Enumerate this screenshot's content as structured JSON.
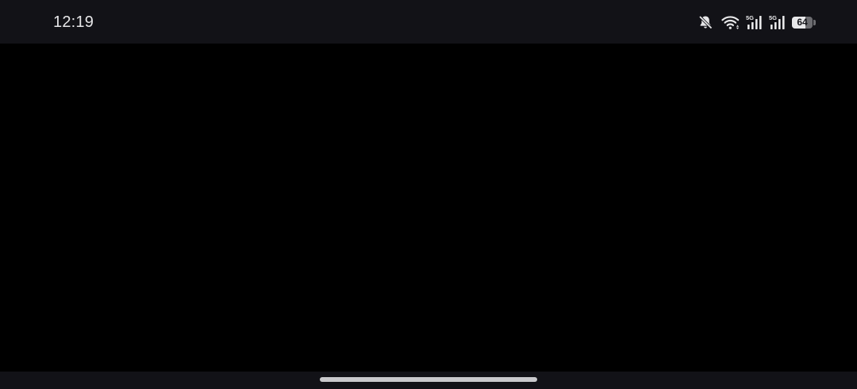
{
  "status_bar": {
    "time": "12:19",
    "icons": [
      "bell-off-icon",
      "wifi-icon",
      "signal-5g-icon",
      "signal-5g-icon",
      "battery-icon"
    ],
    "signal_label": "5G",
    "battery": {
      "level": 64,
      "label": "64"
    }
  },
  "colors": {
    "bars": "#121217",
    "content": "#000000",
    "text": "#e6e6e8",
    "handle": "#c9c9cc"
  }
}
